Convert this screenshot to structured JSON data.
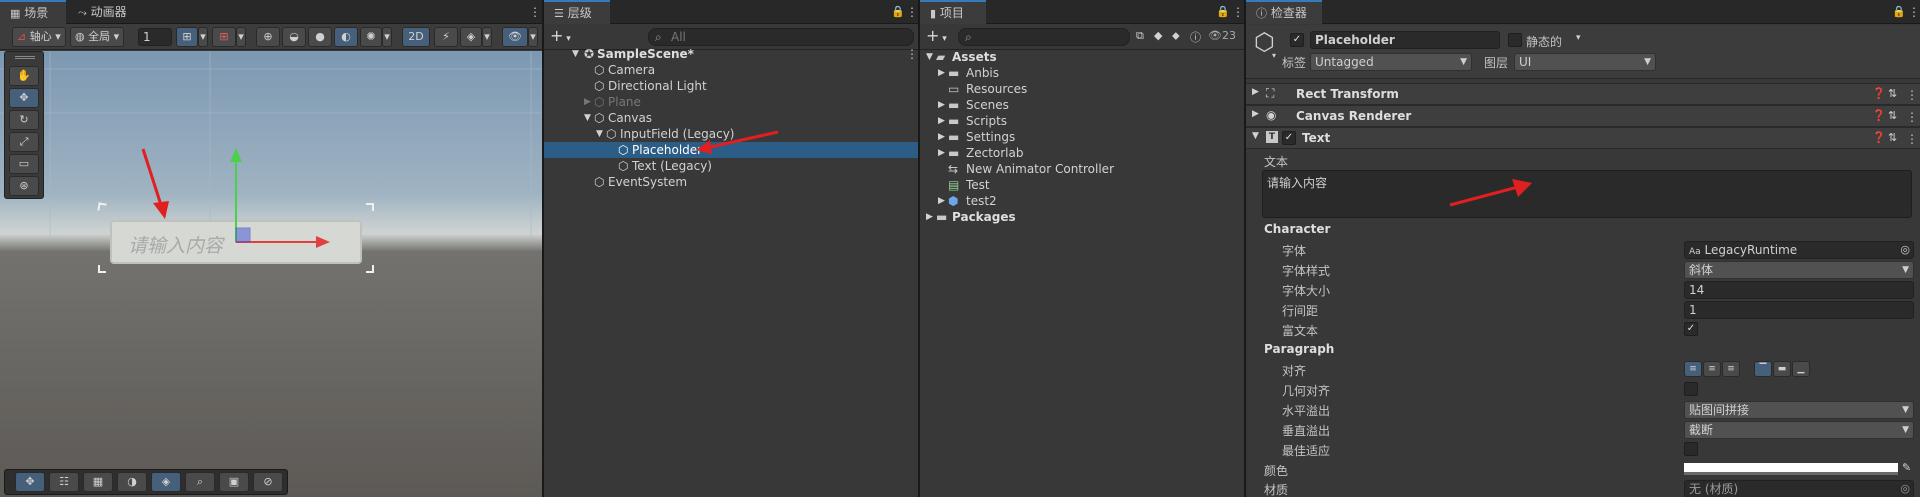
{
  "scene": {
    "tabs": [
      "场景",
      "动画器"
    ],
    "pivot": "轴心",
    "global": "全局",
    "layer_field": "1",
    "mode_2d": "2D",
    "input_text": "请输入内容"
  },
  "hierarchy": {
    "tab": "层级",
    "search_placeholder": "All",
    "items": [
      {
        "label": "SampleScene*"
      },
      {
        "label": "Camera"
      },
      {
        "label": "Directional Light"
      },
      {
        "label": "Plane"
      },
      {
        "label": "Canvas"
      },
      {
        "label": "InputField (Legacy)"
      },
      {
        "label": "Placeholder"
      },
      {
        "label": "Text (Legacy)"
      },
      {
        "label": "EventSystem"
      }
    ]
  },
  "project": {
    "tab": "项目",
    "hidden_count": "23",
    "items": [
      {
        "label": "Assets"
      },
      {
        "label": "Anbis"
      },
      {
        "label": "Resources"
      },
      {
        "label": "Scenes"
      },
      {
        "label": "Scripts"
      },
      {
        "label": "Settings"
      },
      {
        "label": "Zectorlab"
      },
      {
        "label": "New Animator Controller"
      },
      {
        "label": "Test"
      },
      {
        "label": "test2"
      },
      {
        "label": "Packages"
      }
    ]
  },
  "inspector": {
    "tab": "检查器",
    "object_name": "Placeholder",
    "static_label": "静态的",
    "tag_label": "标签",
    "tag_value": "Untagged",
    "layer_label": "图层",
    "layer_value": "UI",
    "components": {
      "rect_transform": "Rect Transform",
      "canvas_renderer": "Canvas Renderer",
      "text": "Text"
    },
    "text_section_label": "文本",
    "text_value": "请输入内容",
    "character_header": "Character",
    "font_label": "字体",
    "font_value": "LegacyRuntime",
    "font_style_label": "字体样式",
    "font_style_value": "斜体",
    "font_size_label": "字体大小",
    "font_size_value": "14",
    "line_spacing_label": "行间距",
    "line_spacing_value": "1",
    "rich_text_label": "富文本",
    "paragraph_header": "Paragraph",
    "alignment_label": "对齐",
    "align_by_geometry_label": "几何对齐",
    "h_overflow_label": "水平溢出",
    "h_overflow_value": "贴图间拼接",
    "v_overflow_label": "垂直溢出",
    "v_overflow_value": "截断",
    "best_fit_label": "最佳适应",
    "color_label": "颜色",
    "material_label": "材质",
    "material_value": "无 (材质)"
  },
  "colors": {
    "selection": "#2c5d87",
    "accent_tab": "#3a79bb",
    "annotation_arrow": "#e02020"
  }
}
